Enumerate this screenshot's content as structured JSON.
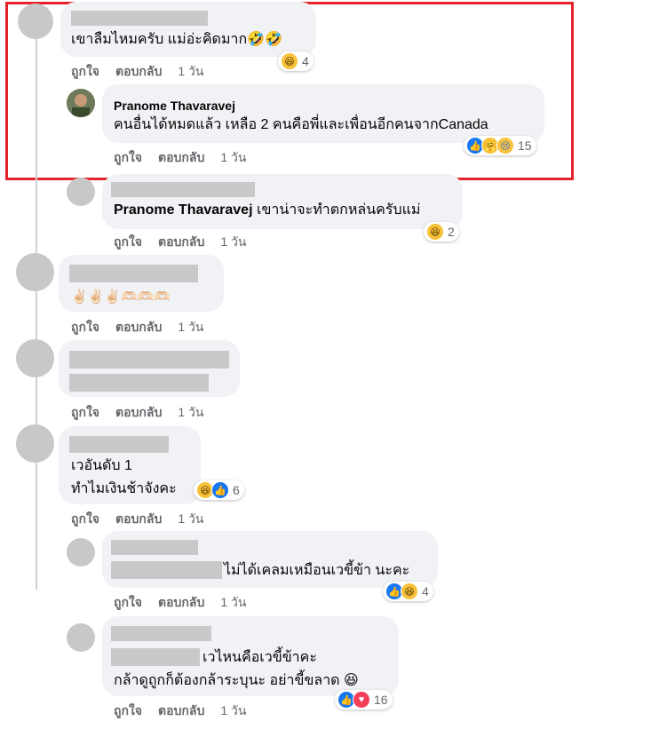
{
  "actions": {
    "like": "ถูกใจ",
    "reply": "ตอบกลับ",
    "time": "1 วัน"
  },
  "comments": [
    {
      "text": "เขาลืมไหมครับ แม่อ่ะคิดมาก🤣🤣",
      "reactions": {
        "count": "4",
        "icons": [
          "haha-icon"
        ]
      }
    },
    {
      "author": "Pranome Thavaravej",
      "text": "คนอื่นได้หมดแล้ว เหลือ 2 คนคือพี่และเพื่อนอีกคนจากCanada",
      "reactions": {
        "count": "15",
        "icons": [
          "like-icon",
          "care-icon",
          "sad-icon"
        ]
      }
    },
    {
      "mention": "Pranome Thavaravej",
      "text": " เขาน่าจะทำตกหล่นครับแม่",
      "reactions": {
        "count": "2",
        "icons": [
          "haha-icon"
        ]
      }
    },
    {
      "text": "✌🏻✌🏻✌🏻🫶🏻🫶🏻🫶🏻"
    },
    {
      "text": ""
    },
    {
      "line1": "เวอันดับ 1",
      "line2": "ทำไมเงินช้าจังคะ",
      "reactions": {
        "count": "6",
        "icons": [
          "haha-icon",
          "like-icon"
        ]
      }
    },
    {
      "text": "ไม่ได้เคลมเหมือนเวขี้ข้า นะคะ",
      "reactions": {
        "count": "4",
        "icons": [
          "like-icon",
          "haha-icon"
        ]
      }
    },
    {
      "line1": "เวไหนคือเวขี้ข้าคะ",
      "line2": "กล้าดูถูกก็ต้องกล้าระบุนะ อย่าขี้ขลาด 😆",
      "reactions": {
        "count": "16",
        "icons": [
          "like-icon",
          "love-icon"
        ]
      }
    }
  ],
  "colors": {
    "highlight": "#e5232c",
    "redaction": "#c9c9c9",
    "bubble": "#f0f2f5",
    "meta": "#65676b"
  }
}
